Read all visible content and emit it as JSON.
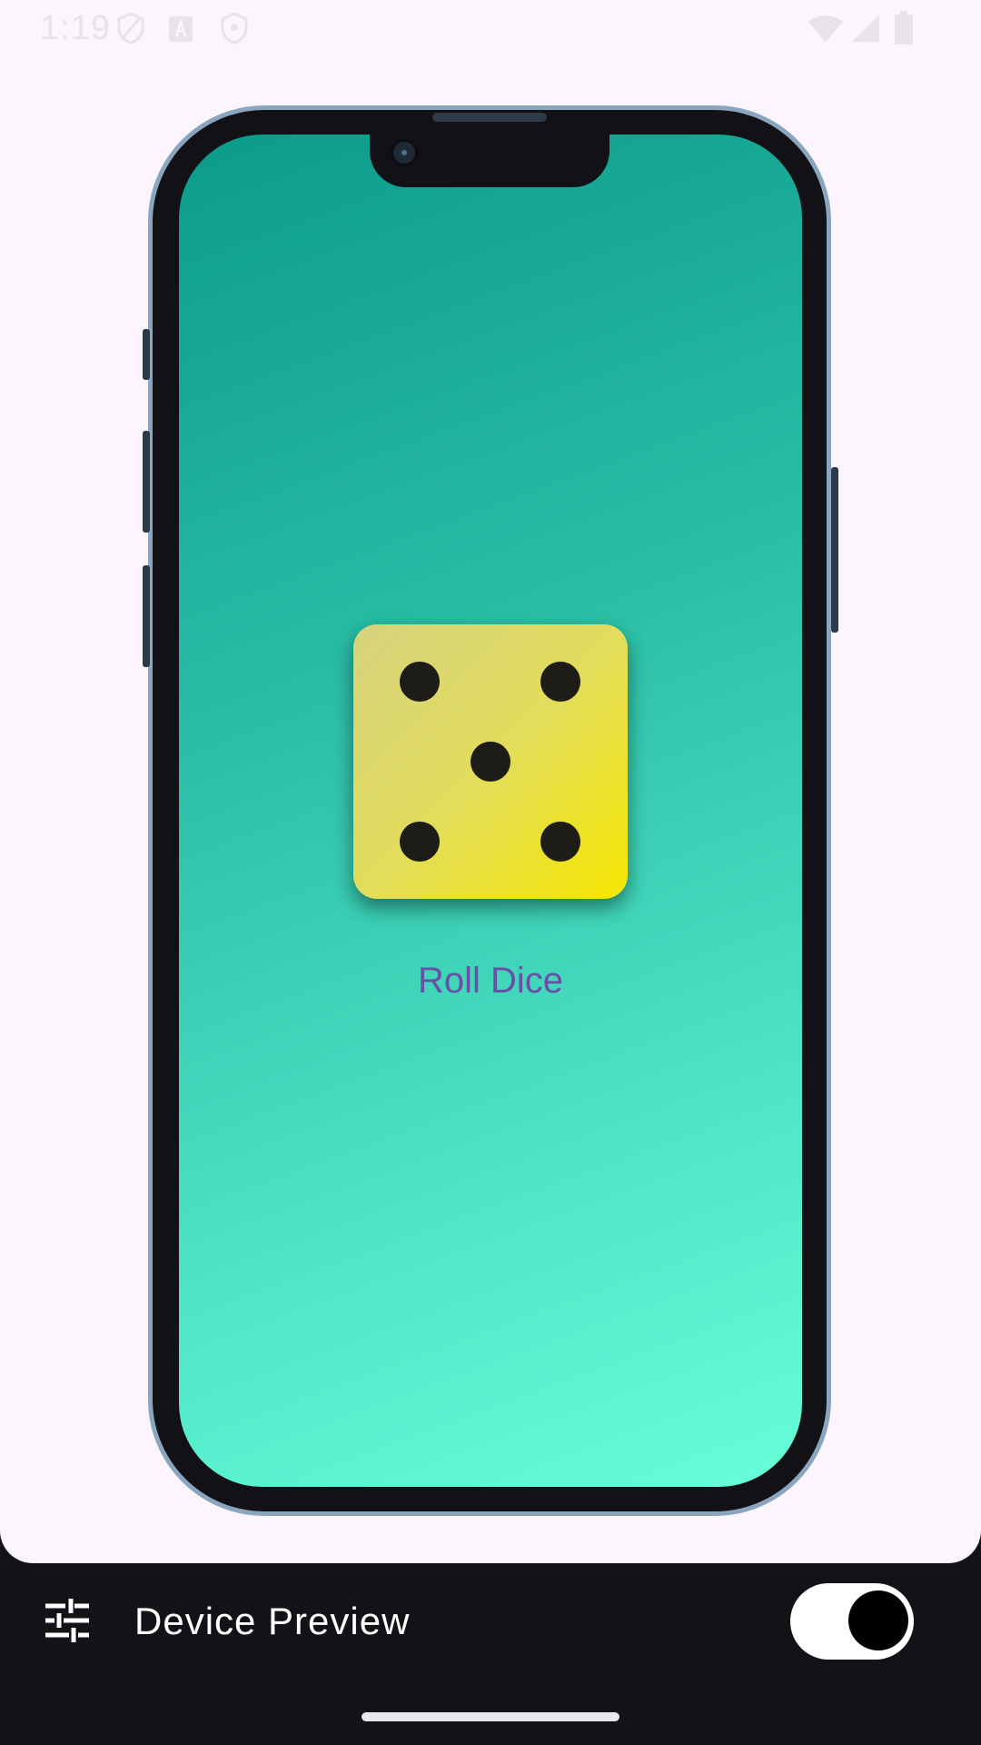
{
  "status_bar": {
    "time": "1:19",
    "icons": [
      "shield-icon",
      "a-icon",
      "shield-outline-icon",
      "wifi-icon",
      "signal-icon",
      "battery-icon"
    ]
  },
  "device": {
    "frame_color": "#8aa6bf",
    "screen_gradient": [
      "#0b9b8b",
      "#66ffd9"
    ]
  },
  "app": {
    "dice_face_value": 5,
    "dice_colors": [
      "#d6d27d",
      "#f5e600"
    ],
    "roll_button_label": "Roll Dice",
    "roll_button_color": "#6a4fa6"
  },
  "bottom_bar": {
    "settings_icon": "tune-icon",
    "title": "Device Preview",
    "toggle_on": true
  }
}
